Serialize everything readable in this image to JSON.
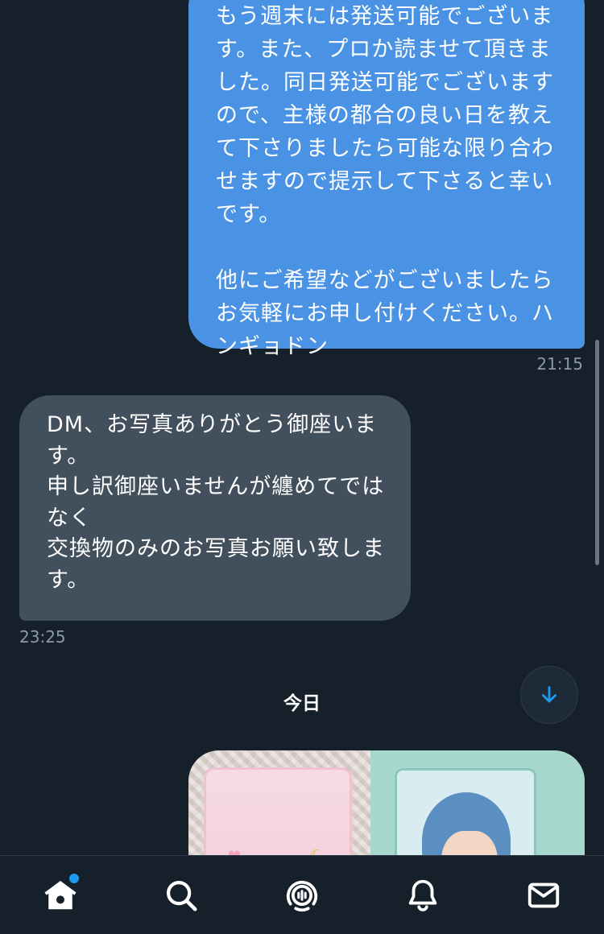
{
  "conversation": {
    "sent_message": {
      "text": "もう週末には発送可能でございます。また、プロか読ませて頂きました。同日発送可能でございますので、主様の都合の良い日を教えて下さりましたら可能な限り合わせますので提示して下さると幸いです。\n\n他にご希望などがございましたらお気軽にお申し付けください。ハンギョドン",
      "time": "21:15"
    },
    "received_message": {
      "text": "DM、お写真ありがとう御座います。\n申し訳御座いませんが纏めてではなく\n交換物のみのお写真お願い致します。",
      "time": "23:25"
    },
    "date_separator": "今日",
    "photo_message": {
      "image": "trading-cards-photo"
    }
  },
  "tab_bar": {
    "tabs": [
      {
        "name": "home",
        "icon": "home-icon",
        "active": true,
        "notification_dot": true
      },
      {
        "name": "search",
        "icon": "search-icon",
        "active": false
      },
      {
        "name": "spaces",
        "icon": "spaces-icon",
        "active": false
      },
      {
        "name": "notifications",
        "icon": "bell-icon",
        "active": false
      },
      {
        "name": "messages",
        "icon": "mail-icon",
        "active": false
      }
    ]
  },
  "colors": {
    "background": "#15202b",
    "sent_bubble": "#4a93e4",
    "received_bubble": "#424f5c",
    "accent": "#1d9bf0",
    "timestamp": "#8b98a5"
  }
}
